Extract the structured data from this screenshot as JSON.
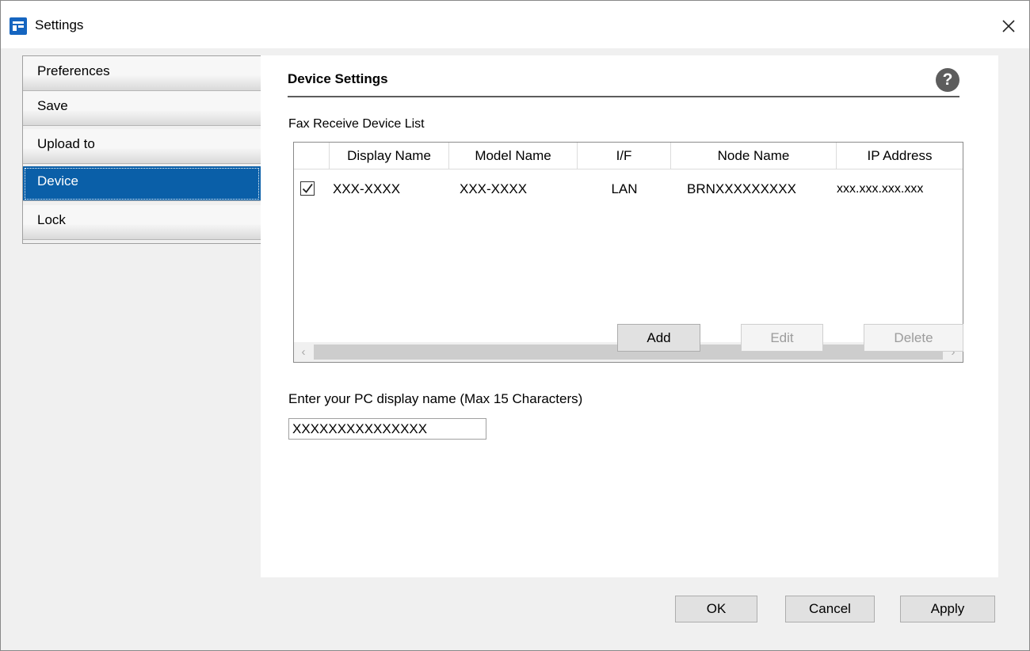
{
  "window": {
    "title": "Settings",
    "close_glyph": "✕"
  },
  "sidebar": {
    "items": [
      {
        "label": "Preferences",
        "selected": false
      },
      {
        "label": "Save",
        "selected": false
      },
      {
        "label": "Upload to",
        "selected": false
      },
      {
        "label": "Device",
        "selected": true
      },
      {
        "label": "Lock",
        "selected": false
      }
    ]
  },
  "content": {
    "title": "Device Settings",
    "help_glyph": "?",
    "list_label": "Fax Receive Device List",
    "columns": [
      "Display Name",
      "Model Name",
      "I/F",
      "Node Name",
      "IP Address"
    ],
    "rows": [
      {
        "checked": true,
        "display_name": "XXX-XXXX",
        "model_name": "XXX-XXXX",
        "interface": "LAN",
        "node_name": "BRNXXXXXXXXX",
        "ip_address": "xxx.xxx.xxx.xxx"
      }
    ],
    "scroll_left_glyph": "‹",
    "scroll_right_glyph": "›",
    "buttons": {
      "add": {
        "label": "Add",
        "enabled": true
      },
      "edit": {
        "label": "Edit",
        "enabled": false
      },
      "delete": {
        "label": "Delete",
        "enabled": false
      }
    },
    "pc_name_label": "Enter your PC display name (Max 15 Characters)",
    "pc_name_value": "XXXXXXXXXXXXXXX"
  },
  "footer": {
    "ok_label": "OK",
    "cancel_label": "Cancel",
    "apply_label": "Apply"
  },
  "colors": {
    "selection": "#0a5fa8",
    "app_icon": "#1565c0"
  }
}
